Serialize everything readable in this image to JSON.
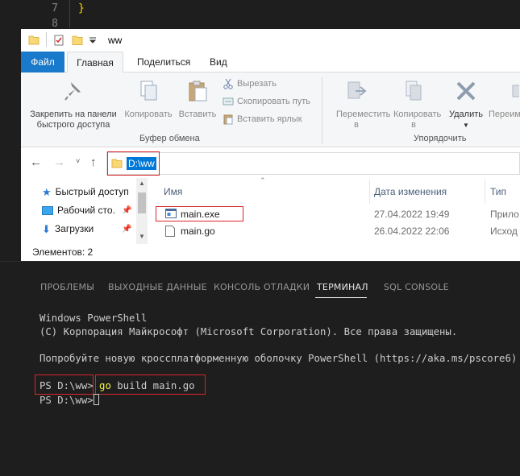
{
  "editor": {
    "lines": [
      {
        "num": "7",
        "text": "}"
      },
      {
        "num": "8",
        "text": ""
      }
    ]
  },
  "explorer": {
    "title": "ww",
    "tabs": {
      "file": "Файл",
      "home": "Главная",
      "share": "Поделиться",
      "view": "Вид"
    },
    "ribbon": {
      "pin": "Закрепить на панели быстрого доступа",
      "copy": "Копировать",
      "paste": "Вставить",
      "cut": "Вырезать",
      "copy_path": "Скопировать путь",
      "paste_shortcut": "Вставить ярлык",
      "clipboard_group": "Буфер обмена",
      "move_to": "Переместить в",
      "copy_to": "Копировать в",
      "delete": "Удалить",
      "rename": "Переим",
      "organize_group": "Упорядочить"
    },
    "address": "D:\\ww",
    "nav_pane": [
      {
        "label": "Быстрый доступ"
      },
      {
        "label": "Рабочий сто."
      },
      {
        "label": "Загрузки"
      }
    ],
    "columns": {
      "name": "Имя",
      "date": "Дата изменения",
      "type": "Тип"
    },
    "files": [
      {
        "name": "main.exe",
        "date": "27.04.2022 19:49",
        "type": "Прило"
      },
      {
        "name": "main.go",
        "date": "26.04.2022 22:06",
        "type": "Исход"
      }
    ],
    "status": "Элементов: 2"
  },
  "panel": {
    "tabs": {
      "problems": "ПРОБЛЕМЫ",
      "output": "ВЫХОДНЫЕ ДАННЫЕ",
      "debug": "КОНСОЛЬ ОТЛАДКИ",
      "terminal": "ТЕРМИНАЛ",
      "sql": "SQL CONSOLE"
    },
    "terminal": {
      "line1": "Windows PowerShell",
      "line2": "(C) Корпорация Майкрософт (Microsoft Corporation). Все права защищены.",
      "line3": "Попробуйте новую кроссплатформенную оболочку PowerShell (https://aka.ms/pscore6)",
      "prompt": "PS D:\\ww>",
      "cmd_keyword": "go",
      "cmd_rest": " build main.go"
    }
  }
}
